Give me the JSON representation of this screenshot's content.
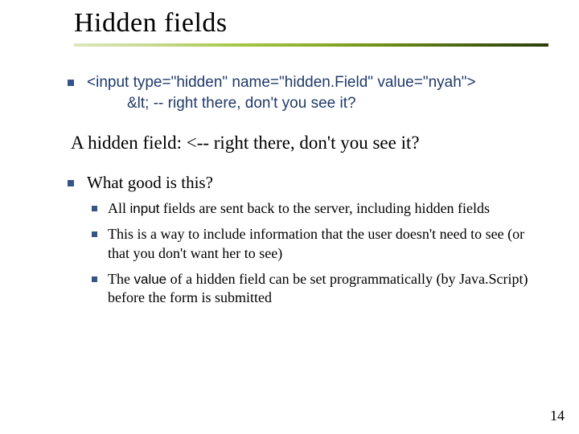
{
  "title": "Hidden fields",
  "bullet1": {
    "line1": "<input type=\"hidden\" name=\"hidden.Field\" value=\"nyah\">",
    "line2": "&lt; -- right there, don't you see it?"
  },
  "rendered_example": "A hidden field: <-- right there, don't you see it?",
  "bullet2": {
    "lead": "What good is this?",
    "sub": [
      {
        "pre": "All ",
        "code": "input",
        "post": " fields are sent back to the server, including hidden fields"
      },
      {
        "pre": "This is a way to include information that the user doesn't need to see (or that you don't want her to see)",
        "code": "",
        "post": ""
      },
      {
        "pre": "The ",
        "code": "value",
        "post": " of a hidden field can be set programmatically (by Java.Script) before the form is submitted"
      }
    ]
  },
  "page_number": "14"
}
